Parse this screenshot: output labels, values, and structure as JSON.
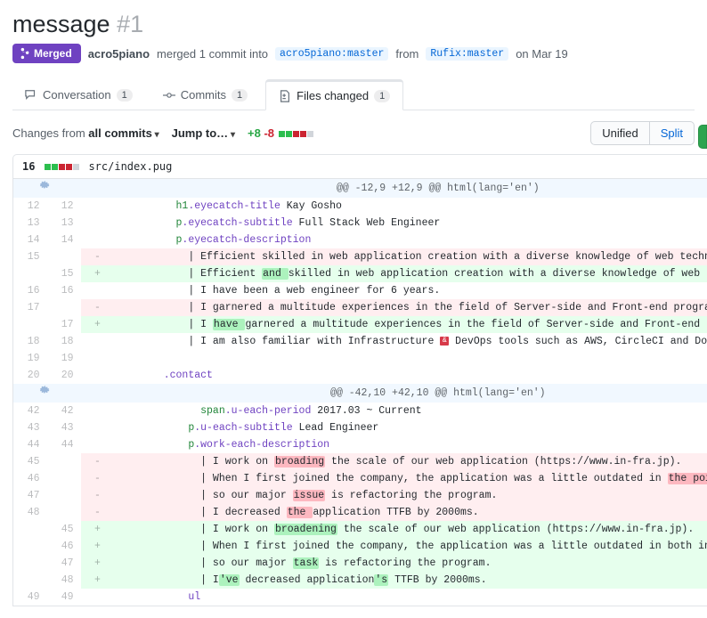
{
  "title": "message",
  "pr_number": "#1",
  "state": "Merged",
  "author": "acro5piano",
  "merge_text": "merged 1 commit into",
  "base_branch": "acro5piano:master",
  "from_text": "from",
  "head_branch": "Rufix:master",
  "date_text": "on Mar 19",
  "tabs": {
    "conversation": {
      "label": "Conversation",
      "count": "1"
    },
    "commits": {
      "label": "Commits",
      "count": "1"
    },
    "files": {
      "label": "Files changed",
      "count": "1"
    }
  },
  "toolbar": {
    "changes_from_label": "Changes from",
    "changes_from_value": "all commits",
    "jump_to_label": "Jump to…",
    "additions": "+8",
    "deletions": "-8",
    "unified": "Unified",
    "split": "Split"
  },
  "file": {
    "lines": "16",
    "path": "src/index.pug"
  },
  "diff": [
    {
      "type": "hunk",
      "text": "@@ -12,9 +12,9 @@ html(lang='en')"
    },
    {
      "type": "ctx",
      "ol": "12",
      "nl": "12",
      "segs": [
        [
          "p",
          "          "
        ],
        [
          "t",
          "h1"
        ],
        [
          "c",
          ".eyecatch-title"
        ],
        [
          "p",
          " Kay Gosho"
        ]
      ]
    },
    {
      "type": "ctx",
      "ol": "13",
      "nl": "13",
      "segs": [
        [
          "p",
          "          "
        ],
        [
          "t",
          "p"
        ],
        [
          "c",
          ".eyecatch-subtitle"
        ],
        [
          "p",
          " Full Stack Web Engineer"
        ]
      ]
    },
    {
      "type": "ctx",
      "ol": "14",
      "nl": "14",
      "segs": [
        [
          "p",
          "          "
        ],
        [
          "t",
          "p"
        ],
        [
          "c",
          ".eyecatch-description"
        ]
      ]
    },
    {
      "type": "del",
      "ol": "15",
      "nl": "",
      "segs": [
        [
          "p",
          "            | Efficient skilled in web application creation with a diverse knowledge of web technologies,"
        ]
      ]
    },
    {
      "type": "add",
      "ol": "",
      "nl": "15",
      "segs": [
        [
          "p",
          "            | Efficient "
        ],
        [
          "xa",
          "and "
        ],
        [
          "p",
          "skilled in web application creation with a diverse knowledge of web technolog"
        ]
      ]
    },
    {
      "type": "ctx",
      "ol": "16",
      "nl": "16",
      "segs": [
        [
          "p",
          "            | I have been a web engineer for 6 years."
        ]
      ]
    },
    {
      "type": "del",
      "ol": "17",
      "nl": "",
      "segs": [
        [
          "p",
          "            | I garnered a multitude experiences in the field of Server-side and Front-end programming, F"
        ]
      ]
    },
    {
      "type": "add",
      "ol": "",
      "nl": "17",
      "segs": [
        [
          "p",
          "            | I "
        ],
        [
          "xa",
          "have "
        ],
        [
          "p",
          "garnered a multitude experiences in the field of Server-side and Front-end programmi"
        ]
      ]
    },
    {
      "type": "ctx",
      "ol": "18",
      "nl": "18",
      "segs": [
        [
          "p",
          "            | I am also familiar with Infrastructure "
        ],
        [
          "e",
          ""
        ],
        [
          "p",
          " DevOps tools such as AWS, CircleCI and Docker."
        ]
      ]
    },
    {
      "type": "ctx",
      "ol": "19",
      "nl": "19",
      "segs": [
        [
          "p",
          ""
        ]
      ]
    },
    {
      "type": "ctx",
      "ol": "20",
      "nl": "20",
      "segs": [
        [
          "p",
          "        "
        ],
        [
          "c",
          ".contact"
        ]
      ]
    },
    {
      "type": "hunk",
      "text": "@@ -42,10 +42,10 @@ html(lang='en')"
    },
    {
      "type": "ctx",
      "ol": "42",
      "nl": "42",
      "segs": [
        [
          "p",
          "              "
        ],
        [
          "t",
          "span"
        ],
        [
          "c",
          ".u-each-period"
        ],
        [
          "p",
          " 2017.03 ~ Current"
        ]
      ]
    },
    {
      "type": "ctx",
      "ol": "43",
      "nl": "43",
      "segs": [
        [
          "p",
          "            "
        ],
        [
          "t",
          "p"
        ],
        [
          "c",
          ".u-each-subtitle"
        ],
        [
          "p",
          " Lead Engineer"
        ]
      ]
    },
    {
      "type": "ctx",
      "ol": "44",
      "nl": "44",
      "segs": [
        [
          "p",
          "            "
        ],
        [
          "t",
          "p"
        ],
        [
          "c",
          ".work-each-description"
        ]
      ]
    },
    {
      "type": "del",
      "ol": "45",
      "nl": "",
      "segs": [
        [
          "p",
          "              | I work on "
        ],
        [
          "xd",
          "broading"
        ],
        [
          "p",
          " the scale of our web application (https://www.in-fra.jp)."
        ]
      ]
    },
    {
      "type": "del",
      "ol": "46",
      "nl": "",
      "segs": [
        [
          "p",
          "              | When I first joined the company, the application was a little outdated in "
        ],
        [
          "xd",
          "the point of "
        ]
      ]
    },
    {
      "type": "del",
      "ol": "47",
      "nl": "",
      "segs": [
        [
          "p",
          "              | so our major "
        ],
        [
          "xd",
          "issue"
        ],
        [
          "p",
          " is refactoring the program."
        ]
      ]
    },
    {
      "type": "del",
      "ol": "48",
      "nl": "",
      "segs": [
        [
          "p",
          "              | I decreased "
        ],
        [
          "xd",
          "the "
        ],
        [
          "p",
          "application TTFB by 2000ms."
        ]
      ]
    },
    {
      "type": "add",
      "ol": "",
      "nl": "45",
      "segs": [
        [
          "p",
          "              | I work on "
        ],
        [
          "xa",
          "broadening"
        ],
        [
          "p",
          " the scale of our web application (https://www.in-fra.jp)."
        ]
      ]
    },
    {
      "type": "add",
      "ol": "",
      "nl": "46",
      "segs": [
        [
          "p",
          "              | When I first joined the company, the application was a little outdated in both infrastr"
        ]
      ]
    },
    {
      "type": "add",
      "ol": "",
      "nl": "47",
      "segs": [
        [
          "p",
          "              | so our major "
        ],
        [
          "xa",
          "task"
        ],
        [
          "p",
          " is refactoring the program."
        ]
      ]
    },
    {
      "type": "add",
      "ol": "",
      "nl": "48",
      "segs": [
        [
          "p",
          "              | I"
        ],
        [
          "xa",
          "'ve"
        ],
        [
          "p",
          " decreased application"
        ],
        [
          "xa",
          "'s"
        ],
        [
          "p",
          " TTFB by 2000ms."
        ]
      ]
    },
    {
      "type": "ctx",
      "ol": "49",
      "nl": "49",
      "segs": [
        [
          "p",
          "            "
        ],
        [
          "c",
          "ul"
        ]
      ]
    }
  ]
}
